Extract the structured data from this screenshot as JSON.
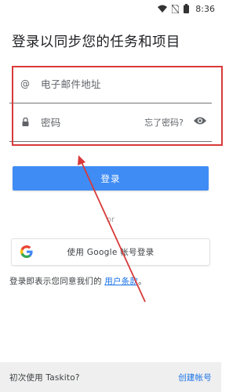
{
  "status_bar": {
    "time": "8:36",
    "icons": [
      "wifi-icon",
      "no-sim-icon",
      "battery-icon"
    ]
  },
  "page": {
    "title": "登录以同步您的任务和项目"
  },
  "email_field": {
    "icon_glyph": "@",
    "placeholder": "电子邮件地址"
  },
  "password_field": {
    "placeholder": "密码",
    "forgot_label": "忘了密码?",
    "icons": [
      "lock-icon",
      "eye-icon"
    ]
  },
  "login_button": {
    "label": "登录"
  },
  "divider": {
    "label": "or"
  },
  "google_button": {
    "label": "使用 Google 帐号登录",
    "icon": "google-logo-icon"
  },
  "terms": {
    "prefix": "登录即表示您同意我们的 ",
    "link": "用户条款",
    "suffix": "。"
  },
  "footer": {
    "prompt": "初次使用 Taskito?",
    "create_account": "创建帐号"
  },
  "annotation": {
    "color": "#d83a3a"
  },
  "colors": {
    "primary": "#3f8cf4",
    "link": "#1a73e8",
    "footer_bg": "#efefef"
  }
}
